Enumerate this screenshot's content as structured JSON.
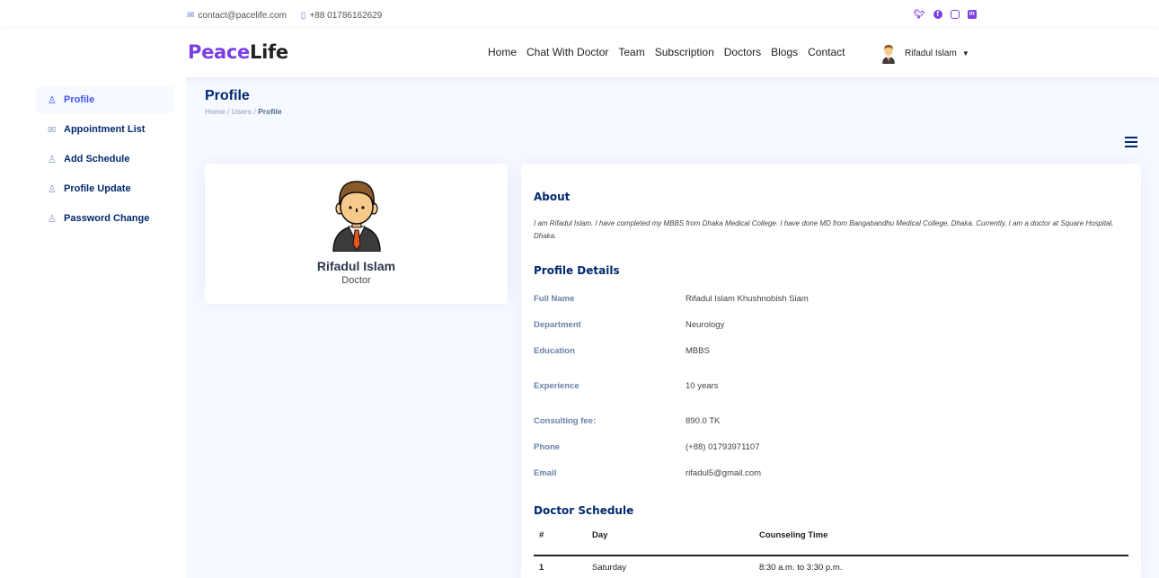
{
  "topbar": {
    "email": "contact@pacelife.com",
    "phone": "+88 01786162629",
    "social": [
      "twitter-icon",
      "facebook-icon",
      "instagram-icon",
      "linkedin-icon"
    ]
  },
  "header": {
    "logo_part1": "Peace",
    "logo_part2": "Life",
    "nav": [
      "Home",
      "Chat With Doctor",
      "Team",
      "Subscription",
      "Doctors",
      "Blogs",
      "Contact"
    ],
    "user_name": "Rifadul Islam"
  },
  "sidebar": {
    "items": [
      {
        "label": "Profile",
        "icon": "person-icon",
        "active": true
      },
      {
        "label": "Appointment List",
        "icon": "envelope-icon",
        "active": false
      },
      {
        "label": "Add Schedule",
        "icon": "person-icon",
        "active": false
      },
      {
        "label": "Profile Update",
        "icon": "person-icon",
        "active": false
      },
      {
        "label": "Password Change",
        "icon": "person-icon",
        "active": false
      }
    ]
  },
  "page": {
    "title": "Profile",
    "breadcrumb": [
      "Home",
      "Users",
      "Profile"
    ]
  },
  "profile_card": {
    "name": "Rifadul Islam",
    "role": "Doctor"
  },
  "about": {
    "heading": "About",
    "text": "I am Rifadul Islam. I have completed my MBBS from Dhaka Medical College. I have done MD from Bangabandhu Medical College, Dhaka. Currently, I am a doctor at Square Hospital, Dhaka."
  },
  "details": {
    "heading": "Profile Details",
    "rows": [
      {
        "label": "Full Name",
        "value": "Rifadul Islam Khushnobish Siam"
      },
      {
        "label": "Department",
        "value": "Neurology"
      },
      {
        "label": "Education",
        "value": "MBBS"
      },
      {
        "label": "Experience",
        "value": "10 years"
      },
      {
        "label": "Consulting fee:",
        "value": "890.0 TK"
      },
      {
        "label": "Phone",
        "value": "(+88) 01793971107"
      },
      {
        "label": "Email",
        "value": "rifadul5@gmail.com"
      }
    ]
  },
  "schedule": {
    "heading": "Doctor Schedule",
    "columns": [
      "#",
      "Day",
      "Counseling Time"
    ],
    "rows": [
      {
        "num": "1",
        "day": "Saturday",
        "time": "8:30 a.m. to 3:30 p.m."
      }
    ]
  }
}
